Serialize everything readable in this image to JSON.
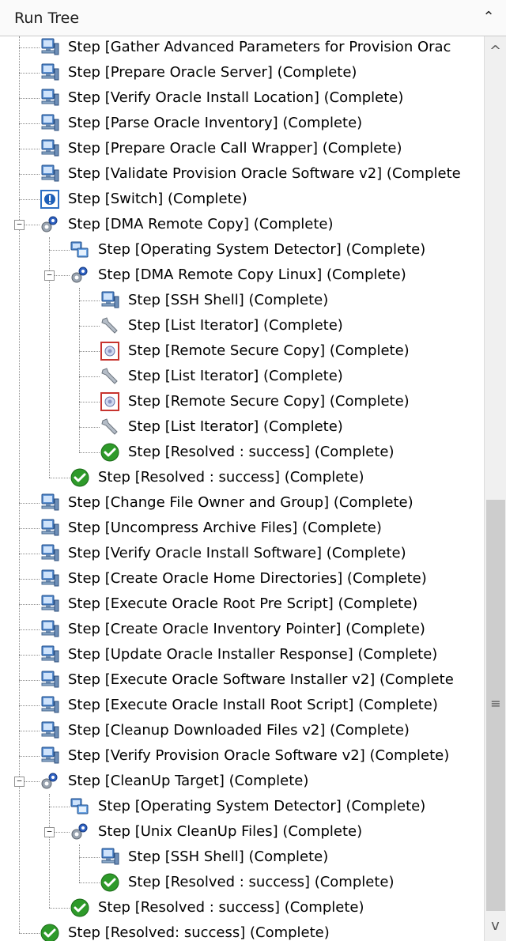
{
  "panel": {
    "title": "Run Tree",
    "collapse_glyph": "⌃"
  },
  "scrollbar": {
    "up_glyph": "^",
    "down_glyph": "v",
    "grip_glyph": "≡"
  },
  "colors": {
    "panel_bg": "#fafafa",
    "tree_text": "#000000",
    "tree_line": "#8e8e8e"
  },
  "tree": {
    "rows": [
      {
        "label": "Step [Gather Advanced Parameters for Provision Orac",
        "icon": "server-icon",
        "depth": 1,
        "expanded": null
      },
      {
        "label": "Step [Prepare Oracle Server] (Complete)",
        "icon": "server-icon",
        "depth": 1,
        "expanded": null
      },
      {
        "label": "Step [Verify Oracle Install Location] (Complete)",
        "icon": "server-icon",
        "depth": 1,
        "expanded": null
      },
      {
        "label": "Step [Parse Oracle Inventory] (Complete)",
        "icon": "server-icon",
        "depth": 1,
        "expanded": null
      },
      {
        "label": "Step [Prepare Oracle Call Wrapper] (Complete)",
        "icon": "server-icon",
        "depth": 1,
        "expanded": null
      },
      {
        "label": "Step [Validate Provision Oracle Software v2] (Complete",
        "icon": "server-icon",
        "depth": 1,
        "expanded": null
      },
      {
        "label": "Step [Switch] (Complete)",
        "icon": "switch-icon",
        "depth": 1,
        "expanded": null
      },
      {
        "label": "Step [DMA Remote Copy] (Complete)",
        "icon": "gear-icon",
        "depth": 1,
        "expanded": true
      },
      {
        "label": "Step [Operating System Detector] (Complete)",
        "icon": "os-detector-icon",
        "depth": 2,
        "expanded": null
      },
      {
        "label": "Step [DMA Remote Copy Linux] (Complete)",
        "icon": "gear-icon",
        "depth": 2,
        "expanded": true
      },
      {
        "label": "Step [SSH Shell] (Complete)",
        "icon": "server-icon",
        "depth": 3,
        "expanded": null
      },
      {
        "label": "Step [List Iterator] (Complete)",
        "icon": "wrench-icon",
        "depth": 3,
        "expanded": null
      },
      {
        "label": "Step [Remote Secure Copy] (Complete)",
        "icon": "secure-copy-icon",
        "depth": 3,
        "expanded": null
      },
      {
        "label": "Step [List Iterator] (Complete)",
        "icon": "wrench-icon",
        "depth": 3,
        "expanded": null
      },
      {
        "label": "Step [Remote Secure Copy] (Complete)",
        "icon": "secure-copy-icon",
        "depth": 3,
        "expanded": null
      },
      {
        "label": "Step [List Iterator] (Complete)",
        "icon": "wrench-icon",
        "depth": 3,
        "expanded": null
      },
      {
        "label": "Step [Resolved : success] (Complete)",
        "icon": "success-check-icon",
        "depth": 3,
        "expanded": null
      },
      {
        "label": "Step [Resolved : success] (Complete)",
        "icon": "success-check-icon",
        "depth": 2,
        "expanded": null
      },
      {
        "label": "Step [Change File Owner and Group] (Complete)",
        "icon": "server-icon",
        "depth": 1,
        "expanded": null
      },
      {
        "label": "Step [Uncompress Archive Files] (Complete)",
        "icon": "server-icon",
        "depth": 1,
        "expanded": null
      },
      {
        "label": "Step [Verify Oracle Install Software] (Complete)",
        "icon": "server-icon",
        "depth": 1,
        "expanded": null
      },
      {
        "label": "Step [Create Oracle Home Directories] (Complete)",
        "icon": "server-icon",
        "depth": 1,
        "expanded": null
      },
      {
        "label": "Step [Execute Oracle Root Pre Script] (Complete)",
        "icon": "server-icon",
        "depth": 1,
        "expanded": null
      },
      {
        "label": "Step [Create Oracle Inventory Pointer] (Complete)",
        "icon": "server-icon",
        "depth": 1,
        "expanded": null
      },
      {
        "label": "Step [Update Oracle Installer Response] (Complete)",
        "icon": "server-icon",
        "depth": 1,
        "expanded": null
      },
      {
        "label": "Step [Execute Oracle Software Installer v2] (Complete",
        "icon": "server-icon",
        "depth": 1,
        "expanded": null
      },
      {
        "label": "Step [Execute Oracle Install Root Script] (Complete)",
        "icon": "server-icon",
        "depth": 1,
        "expanded": null
      },
      {
        "label": "Step [Cleanup Downloaded Files v2] (Complete)",
        "icon": "server-icon",
        "depth": 1,
        "expanded": null
      },
      {
        "label": "Step [Verify Provision Oracle Software v2] (Complete)",
        "icon": "server-icon",
        "depth": 1,
        "expanded": null
      },
      {
        "label": "Step [CleanUp Target] (Complete)",
        "icon": "gear-icon",
        "depth": 1,
        "expanded": true
      },
      {
        "label": "Step [Operating System Detector] (Complete)",
        "icon": "os-detector-icon",
        "depth": 2,
        "expanded": null
      },
      {
        "label": "Step [Unix CleanUp Files] (Complete)",
        "icon": "gear-icon",
        "depth": 2,
        "expanded": true
      },
      {
        "label": "Step [SSH Shell] (Complete)",
        "icon": "server-icon",
        "depth": 3,
        "expanded": null
      },
      {
        "label": "Step [Resolved : success] (Complete)",
        "icon": "success-check-icon",
        "depth": 3,
        "expanded": null
      },
      {
        "label": "Step [Resolved : success] (Complete)",
        "icon": "success-check-icon",
        "depth": 2,
        "expanded": null
      },
      {
        "label": "Step [Resolved: success] (Complete)",
        "icon": "success-check-icon",
        "depth": 1,
        "expanded": null
      }
    ]
  }
}
